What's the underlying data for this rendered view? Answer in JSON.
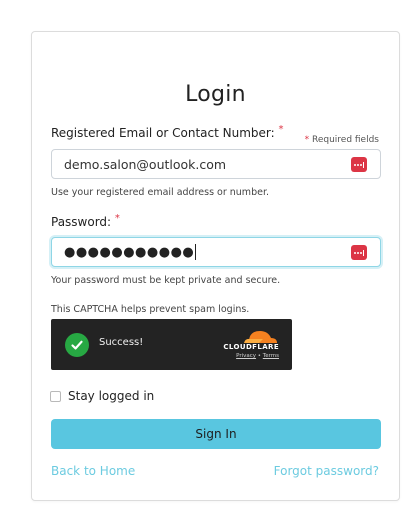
{
  "title": "Login",
  "required_note": {
    "star": "*",
    "text": " Required fields"
  },
  "email": {
    "label": "Registered Email or Contact Number:",
    "star": "*",
    "value": "demo.salon@outlook.com",
    "help": "Use your registered email address or number.",
    "manager_icon": "password-manager-icon"
  },
  "password": {
    "label": "Password:",
    "star": "*",
    "masked_value": "●●●●●●●●●●●",
    "help": "Your password must be kept private and secure.",
    "manager_icon": "password-manager-icon"
  },
  "captcha": {
    "intro": "This CAPTCHA helps prevent spam logins.",
    "status": "Success!",
    "brand": "CLOUDFLARE",
    "privacy": "Privacy",
    "separator": " • ",
    "terms": "Terms"
  },
  "remember": {
    "label": "Stay logged in",
    "checked": false
  },
  "signin": {
    "label": "Sign In"
  },
  "links": {
    "back": "Back to Home",
    "forgot": "Forgot password?"
  },
  "colors": {
    "accent": "#59c6e0",
    "link": "#6ccbe0",
    "required": "#dc3545",
    "success": "#27a843",
    "cloudflare": "#f48120"
  }
}
